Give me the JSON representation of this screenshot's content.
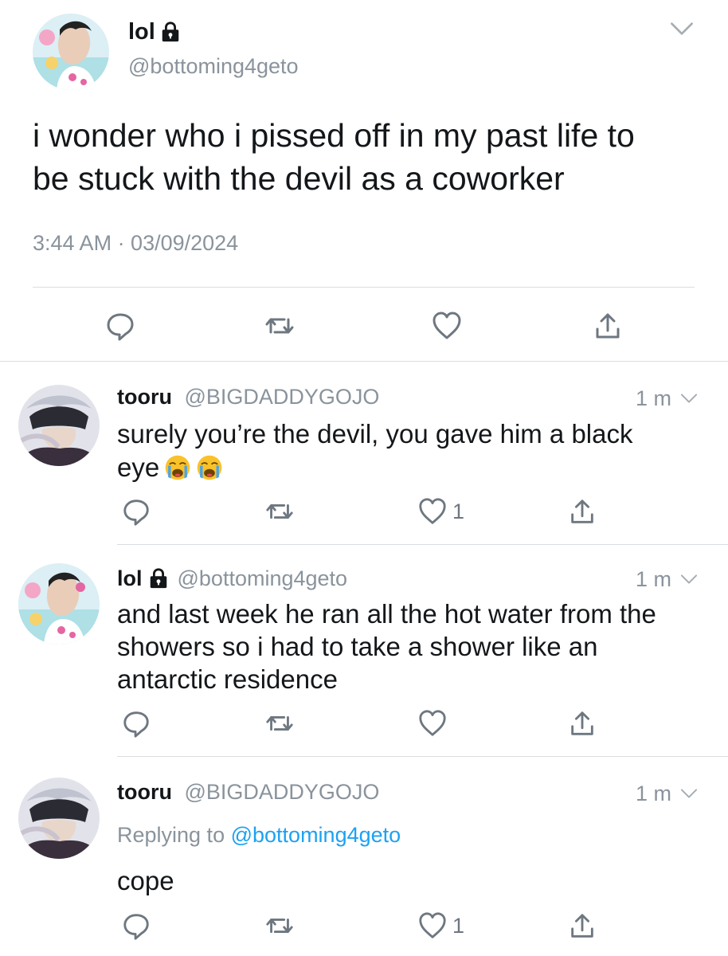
{
  "main_tweet": {
    "display_name": "lol",
    "handle": "@bottoming4geto",
    "text_line1": "i wonder who i pissed off in my past life to",
    "text_line2": "be stuck with the devil as a coworker",
    "timestamp": "3:44 AM · 03/09/2024",
    "icons": [
      "reply-icon",
      "retweet-icon",
      "like-icon",
      "share-icon"
    ]
  },
  "replies": [
    {
      "display_name": "tooru",
      "handle": "@BIGDADDYGOJO",
      "time": "1 m",
      "text_line1": "surely you’re the devil, you gave him a black",
      "text_line2": "eye",
      "emojis": [
        "loudly-crying-face",
        "loudly-crying-face"
      ],
      "like_count": "1"
    },
    {
      "display_name": "lol",
      "handle": "@bottoming4geto",
      "time": "1 m",
      "text_line1": "and last week he ran all the hot water from the",
      "text_line2": "showers so i had to take a shower like an",
      "text_line3": "antarctic residence",
      "like_count": ""
    },
    {
      "display_name": "tooru",
      "handle": "@BIGDADDYGOJO",
      "time": "1 m",
      "replying_prefix": "Replying to",
      "replying_handle": "@bottoming4geto",
      "text": "cope",
      "like_count": "1"
    }
  ],
  "colors": {
    "text": "#14171a",
    "secondary": "#8a939c",
    "link": "#1da1f2",
    "divider": "#dadde0",
    "icon": "#6e7780"
  }
}
